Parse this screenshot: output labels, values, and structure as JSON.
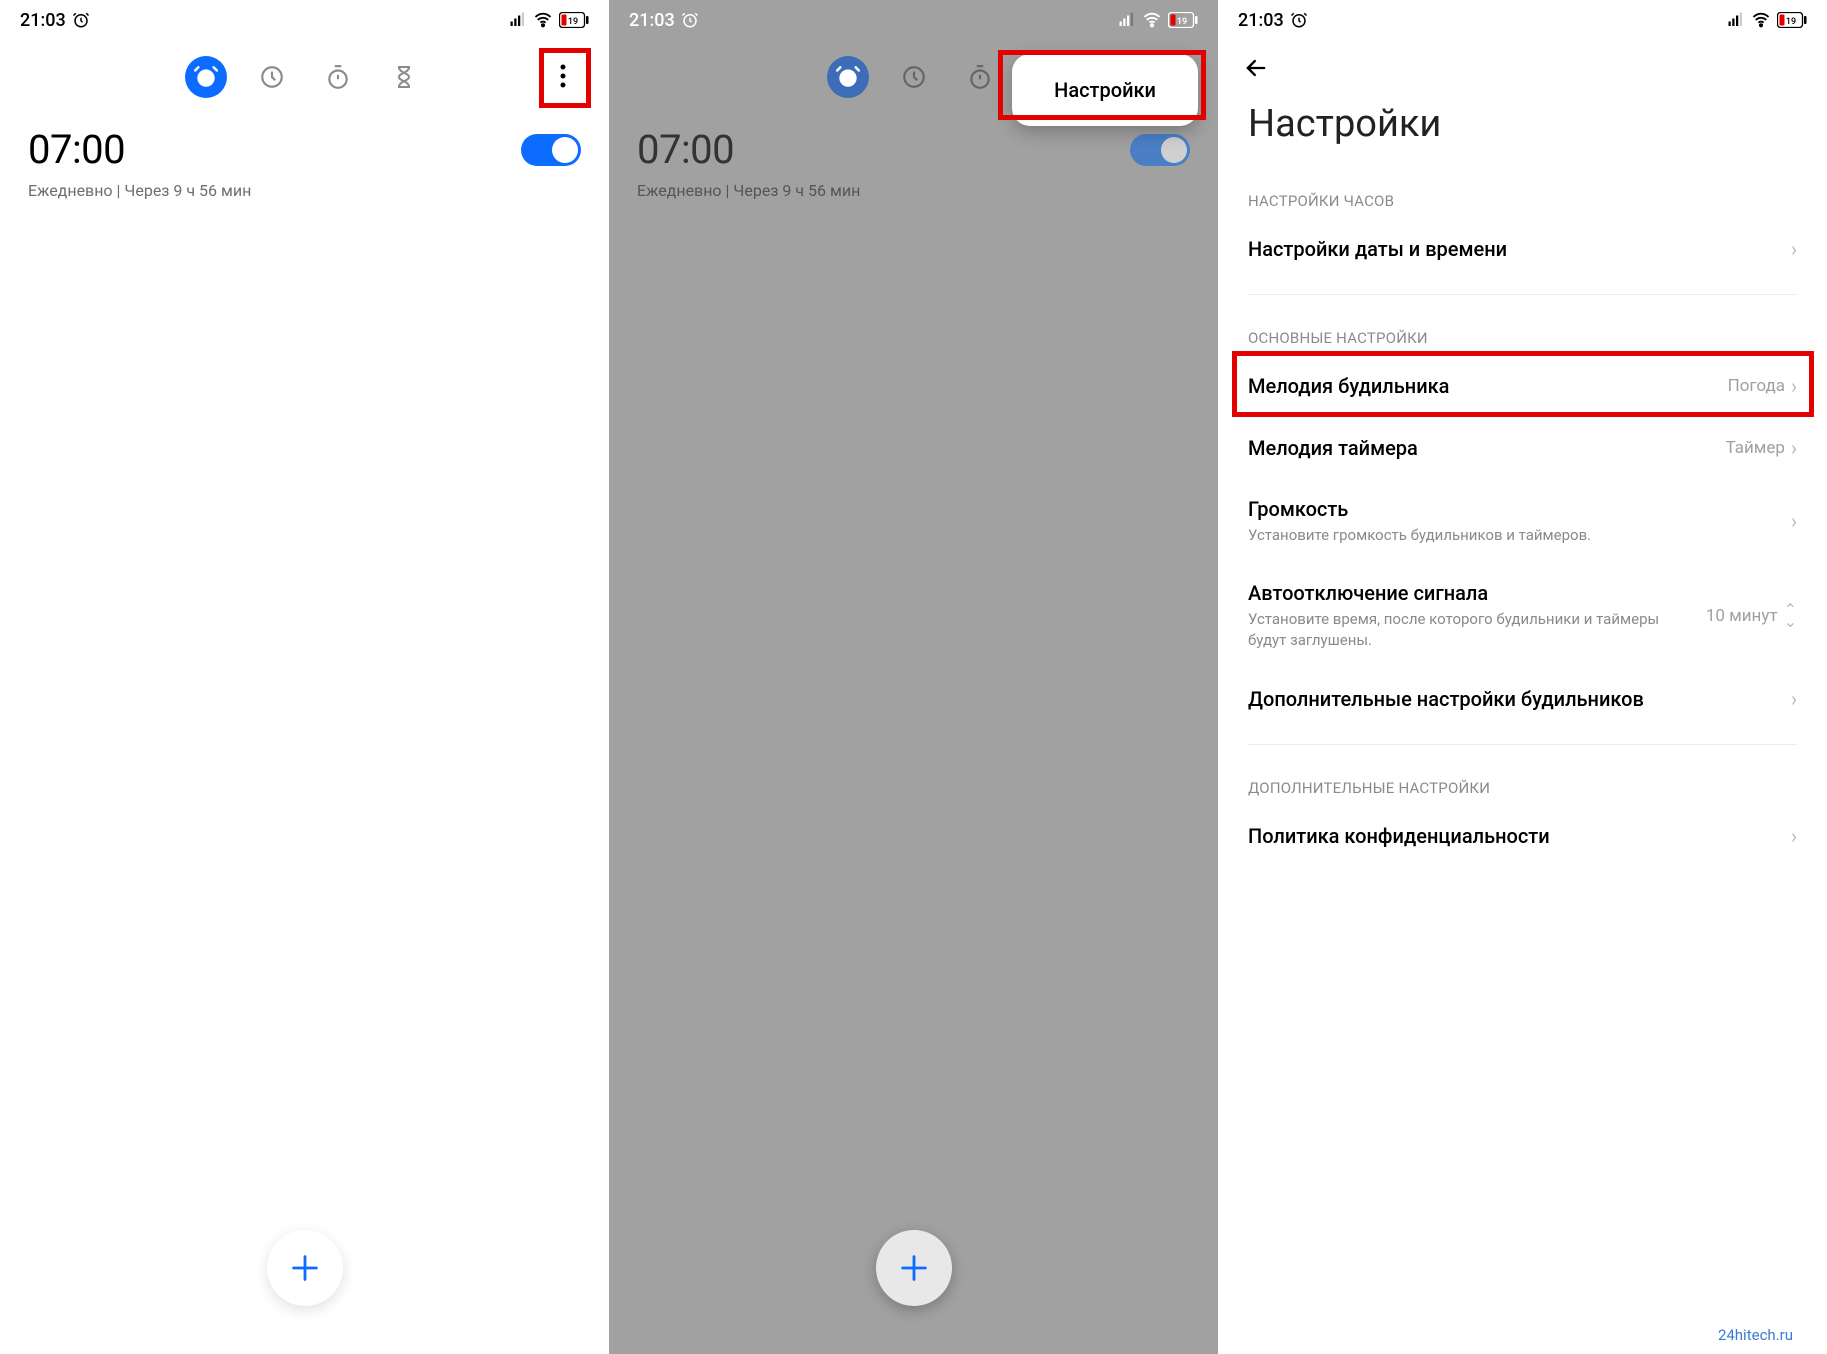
{
  "status": {
    "time": "21:03",
    "battery": "19"
  },
  "alarm": {
    "time": "07:00",
    "repeat": "Ежедневно",
    "separator": " | ",
    "remaining": "Через 9 ч 56 мин"
  },
  "popup": {
    "settings": "Настройки"
  },
  "settings": {
    "title": "Настройки",
    "section_clock": "НАСТРОЙКИ ЧАСОВ",
    "datetime": "Настройки даты и времени",
    "section_main": "ОСНОВНЫЕ НАСТРОЙКИ",
    "ringtone_label": "Мелодия будильника",
    "ringtone_value": "Погода",
    "timer_label": "Мелодия таймера",
    "timer_value": "Таймер",
    "volume_label": "Громкость",
    "volume_sub": "Установите громкость будильников и таймеров.",
    "autooff_label": "Автоотключение сигнала",
    "autooff_sub": "Установите время, после которого будильники и таймеры будут заглушены.",
    "autooff_value": "10 минут",
    "advanced_alarm": "Дополнительные настройки будильников",
    "section_additional": "ДОПОЛНИТЕЛЬНЫЕ НАСТРОЙКИ",
    "privacy": "Политика конфиденциальности"
  },
  "watermark": "24hitech.ru"
}
